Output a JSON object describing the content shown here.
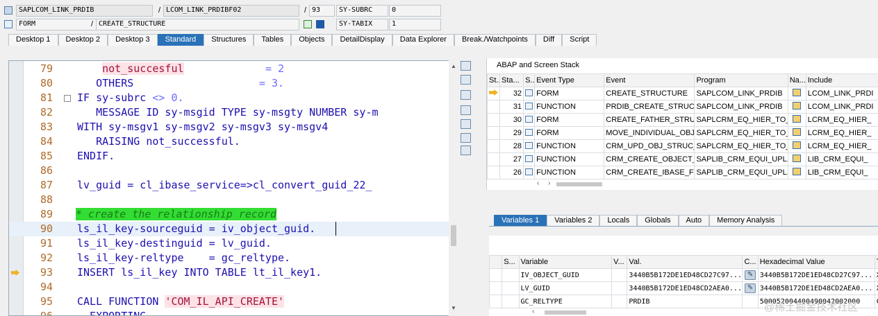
{
  "status_fields": {
    "program": "SAPLCOM_LINK_PRDIB",
    "include": "LCOM_LINK_PRDIBF02",
    "line": "93",
    "sy_subrc_label": "SY-SUBRC",
    "sy_subrc_value": "0",
    "event_type": "FORM",
    "event_name": "CREATE_STRUCTURE",
    "sy_tabix_label": "SY-TABIX",
    "sy_tabix_value": "1",
    "sep1": "/",
    "sep2": "/",
    "sep3": "/",
    "sep4": "/"
  },
  "tabs": [
    "Desktop 1",
    "Desktop 2",
    "Desktop 3",
    "Standard",
    "Structures",
    "Tables",
    "Objects",
    "DetailDisplay",
    "Data Explorer",
    "Break./Watchpoints",
    "Diff",
    "Script"
  ],
  "active_tab": "Standard",
  "code_lines": [
    {
      "n": "79",
      "segs": [
        {
          "c": "plain",
          "t": "    "
        },
        {
          "c": "str",
          "t": "not_succesful"
        },
        {
          "c": "plain",
          "t": "             "
        },
        {
          "c": "op",
          "t": "= 2"
        }
      ]
    },
    {
      "n": "80",
      "segs": [
        {
          "c": "plain",
          "t": "   "
        },
        {
          "c": "kw",
          "t": "OTHERS"
        },
        {
          "c": "plain",
          "t": "                    "
        },
        {
          "c": "op",
          "t": "= 3."
        }
      ]
    },
    {
      "n": "81",
      "segs": [
        {
          "c": "kw",
          "t": "IF"
        },
        {
          "c": "plain",
          "t": " "
        },
        {
          "c": "kw",
          "t": "sy-subrc"
        },
        {
          "c": "plain",
          "t": " "
        },
        {
          "c": "op",
          "t": "<> 0."
        }
      ]
    },
    {
      "n": "82",
      "segs": [
        {
          "c": "plain",
          "t": "   "
        },
        {
          "c": "kw",
          "t": "MESSAGE ID sy-msgid TYPE sy-msgty NUMBER sy-m"
        }
      ]
    },
    {
      "n": "83",
      "segs": [
        {
          "c": "kw",
          "t": "WITH sy-msgv1 sy-msgv2 sy-msgv3 sy-msgv4"
        }
      ]
    },
    {
      "n": "84",
      "segs": [
        {
          "c": "plain",
          "t": "   "
        },
        {
          "c": "kw",
          "t": "RAISING not_successful."
        }
      ]
    },
    {
      "n": "85",
      "segs": [
        {
          "c": "kw",
          "t": "ENDIF."
        }
      ]
    },
    {
      "n": "86",
      "segs": []
    },
    {
      "n": "87",
      "segs": [
        {
          "c": "kw",
          "t": "lv_guid = cl_ibase_service=>cl_convert_guid_22_"
        }
      ]
    },
    {
      "n": "88",
      "segs": []
    },
    {
      "n": "89",
      "segs": [
        {
          "c": "cmt",
          "t": "* create the relationship record"
        }
      ],
      "outdent": true
    },
    {
      "n": "90",
      "segs": [
        {
          "c": "kw",
          "t": "ls_il_key-sourceguid = iv_object_guid."
        }
      ],
      "cur": true
    },
    {
      "n": "91",
      "segs": [
        {
          "c": "kw",
          "t": "ls_il_key-destinguid = lv_guid."
        }
      ]
    },
    {
      "n": "92",
      "segs": [
        {
          "c": "kw",
          "t": "ls_il_key-reltype    = gc_reltype."
        }
      ]
    },
    {
      "n": "93",
      "segs": [
        {
          "c": "kw",
          "t": "INSERT ls_il_key INTO TABLE lt_il_key1."
        }
      ],
      "bp": true
    },
    {
      "n": "94",
      "segs": []
    },
    {
      "n": "95",
      "segs": [
        {
          "c": "kw",
          "t": "CALL FUNCTION"
        },
        {
          "c": "plain",
          "t": " "
        },
        {
          "c": "str",
          "t": "'COM_IL_API_CREATE'"
        }
      ]
    },
    {
      "n": "96",
      "segs": [
        {
          "c": "plain",
          "t": "  "
        },
        {
          "c": "kw",
          "t": "EXPORTING"
        }
      ]
    }
  ],
  "stack": {
    "title": "ABAP and Screen Stack",
    "headers": [
      "St...",
      "Sta...",
      "S...",
      "Event Type",
      "Event",
      "Program",
      "Na...",
      "Include"
    ],
    "rows": [
      {
        "level": "32",
        "type": "FORM",
        "event": "CREATE_STRUCTURE",
        "program": "SAPLCOM_LINK_PRDIB",
        "include": "LCOM_LINK_PRDI",
        "current": true
      },
      {
        "level": "31",
        "type": "FUNCTION",
        "event": "PRDIB_CREATE_STRUCT...",
        "program": "SAPLCOM_LINK_PRDIB",
        "include": "LCOM_LINK_PRDI"
      },
      {
        "level": "30",
        "type": "FORM",
        "event": "CREATE_FATHER_STRU...",
        "program": "SAPLCRM_EQ_HIER_TO_...",
        "include": "LCRM_EQ_HIER_"
      },
      {
        "level": "29",
        "type": "FORM",
        "event": "MOVE_INDIVIDUAL_OBJ...",
        "program": "SAPLCRM_EQ_HIER_TO_...",
        "include": "LCRM_EQ_HIER_"
      },
      {
        "level": "28",
        "type": "FUNCTION",
        "event": "CRM_UPD_OBJ_STRUC_F...",
        "program": "SAPLCRM_EQ_HIER_TO_...",
        "include": "LCRM_EQ_HIER_"
      },
      {
        "level": "27",
        "type": "FUNCTION",
        "event": "CRM_CREATE_OBJECT_F...",
        "program": "SAPLIB_CRM_EQUI_UPL...",
        "include": "LIB_CRM_EQUI_"
      },
      {
        "level": "26",
        "type": "FUNCTION",
        "event": "CRM_CREATE_IBASE_FR...",
        "program": "SAPLIB_CRM_EQUI_UPL...",
        "include": "LIB_CRM_EQUI_"
      }
    ]
  },
  "var_tabs": [
    "Variables 1",
    "Variables 2",
    "Locals",
    "Globals",
    "Auto",
    "Memory Analysis"
  ],
  "active_var_tab": "Variables 1",
  "vars": {
    "headers": [
      "S...",
      "Variable",
      "V...",
      "Val.",
      "C...",
      "Hexadecimal Value",
      "T"
    ],
    "rows": [
      {
        "name": "IV_OBJECT_GUID",
        "val": "3440B5B172DE1ED48CD27C97...",
        "hex": "3440B5B172DE1ED48CD27C97...",
        "t": "X"
      },
      {
        "name": "LV_GUID",
        "val": "3440B5B172DE1ED48CD2AEA0...",
        "hex": "3440B5B172DE1ED48CD2AEA0...",
        "t": "X"
      },
      {
        "name": "GC_RELTYPE",
        "val": "PRDIB",
        "hex": "500052004400490042002000",
        "t": "C"
      }
    ]
  },
  "watermark": "@稀土掘金技术社区"
}
